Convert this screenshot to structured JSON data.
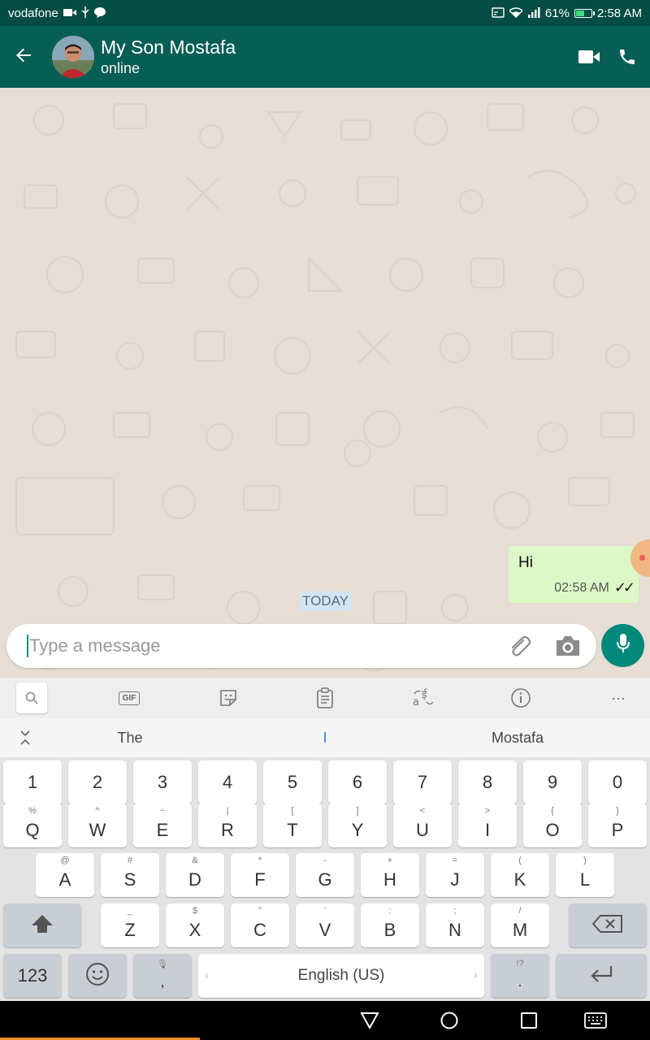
{
  "status_bar": {
    "carrier": "vodafone",
    "battery_percent_label": "61%",
    "battery_level": 0.61,
    "time": "2:58 AM",
    "icons": [
      "video-record-icon",
      "usb-icon",
      "message-icon",
      "cast-icon",
      "wifi-icon",
      "signal-icon",
      "battery-icon"
    ]
  },
  "app_bar": {
    "contact_name": "My Son Mostafa",
    "contact_status": "online",
    "icons": [
      "back-arrow-icon",
      "video-call-icon",
      "voice-call-icon"
    ]
  },
  "chat": {
    "date_divider": "TODAY",
    "messages": [
      {
        "text": "Hi",
        "time": "02:58 AM",
        "status": "read",
        "direction": "outgoing"
      }
    ]
  },
  "composer": {
    "placeholder": "Type a message",
    "value": "",
    "icons": [
      "attach-icon",
      "camera-icon",
      "mic-icon"
    ]
  },
  "keyboard": {
    "toolbar_icons": [
      "search-icon",
      "gif-icon",
      "sticker-icon",
      "clipboard-icon",
      "translate-icon",
      "info-icon",
      "more-icon"
    ],
    "gif_label": "GIF",
    "more_label": "···",
    "suggestions": [
      "The",
      "I",
      "Mostafa"
    ],
    "number_row": [
      "1",
      "2",
      "3",
      "4",
      "5",
      "6",
      "7",
      "8",
      "9",
      "0"
    ],
    "row1": [
      {
        "main": "Q",
        "sub": "%"
      },
      {
        "main": "W",
        "sub": "^"
      },
      {
        "main": "E",
        "sub": "~"
      },
      {
        "main": "R",
        "sub": "|"
      },
      {
        "main": "T",
        "sub": "["
      },
      {
        "main": "Y",
        "sub": "]"
      },
      {
        "main": "U",
        "sub": "<"
      },
      {
        "main": "I",
        "sub": ">"
      },
      {
        "main": "O",
        "sub": "{"
      },
      {
        "main": "P",
        "sub": "}"
      }
    ],
    "row2": [
      {
        "main": "A",
        "sub": "@"
      },
      {
        "main": "S",
        "sub": "#"
      },
      {
        "main": "D",
        "sub": "&"
      },
      {
        "main": "F",
        "sub": "*"
      },
      {
        "main": "G",
        "sub": "-"
      },
      {
        "main": "H",
        "sub": "+"
      },
      {
        "main": "J",
        "sub": "="
      },
      {
        "main": "K",
        "sub": "("
      },
      {
        "main": "L",
        "sub": ")"
      }
    ],
    "row3": [
      {
        "main": "Z",
        "sub": "_"
      },
      {
        "main": "X",
        "sub": "$"
      },
      {
        "main": "C",
        "sub": "\""
      },
      {
        "main": "V",
        "sub": "'"
      },
      {
        "main": "B",
        "sub": ":"
      },
      {
        "main": "N",
        "sub": ";"
      },
      {
        "main": "M",
        "sub": "/"
      }
    ],
    "numbers_key": "123",
    "comma_key": ",",
    "period_key": ".",
    "period_sub": "!?",
    "space_label": "English (US)",
    "space_arrows": [
      "‹",
      "›"
    ]
  },
  "nav_bar": {
    "icons": [
      "back-triangle-icon",
      "home-circle-icon",
      "recents-square-icon",
      "keyboard-switch-icon"
    ]
  },
  "colors": {
    "status_bar": "#054d44",
    "app_bar": "#075e54",
    "bubble_out": "#dcf8c6",
    "accent": "#00897b"
  }
}
